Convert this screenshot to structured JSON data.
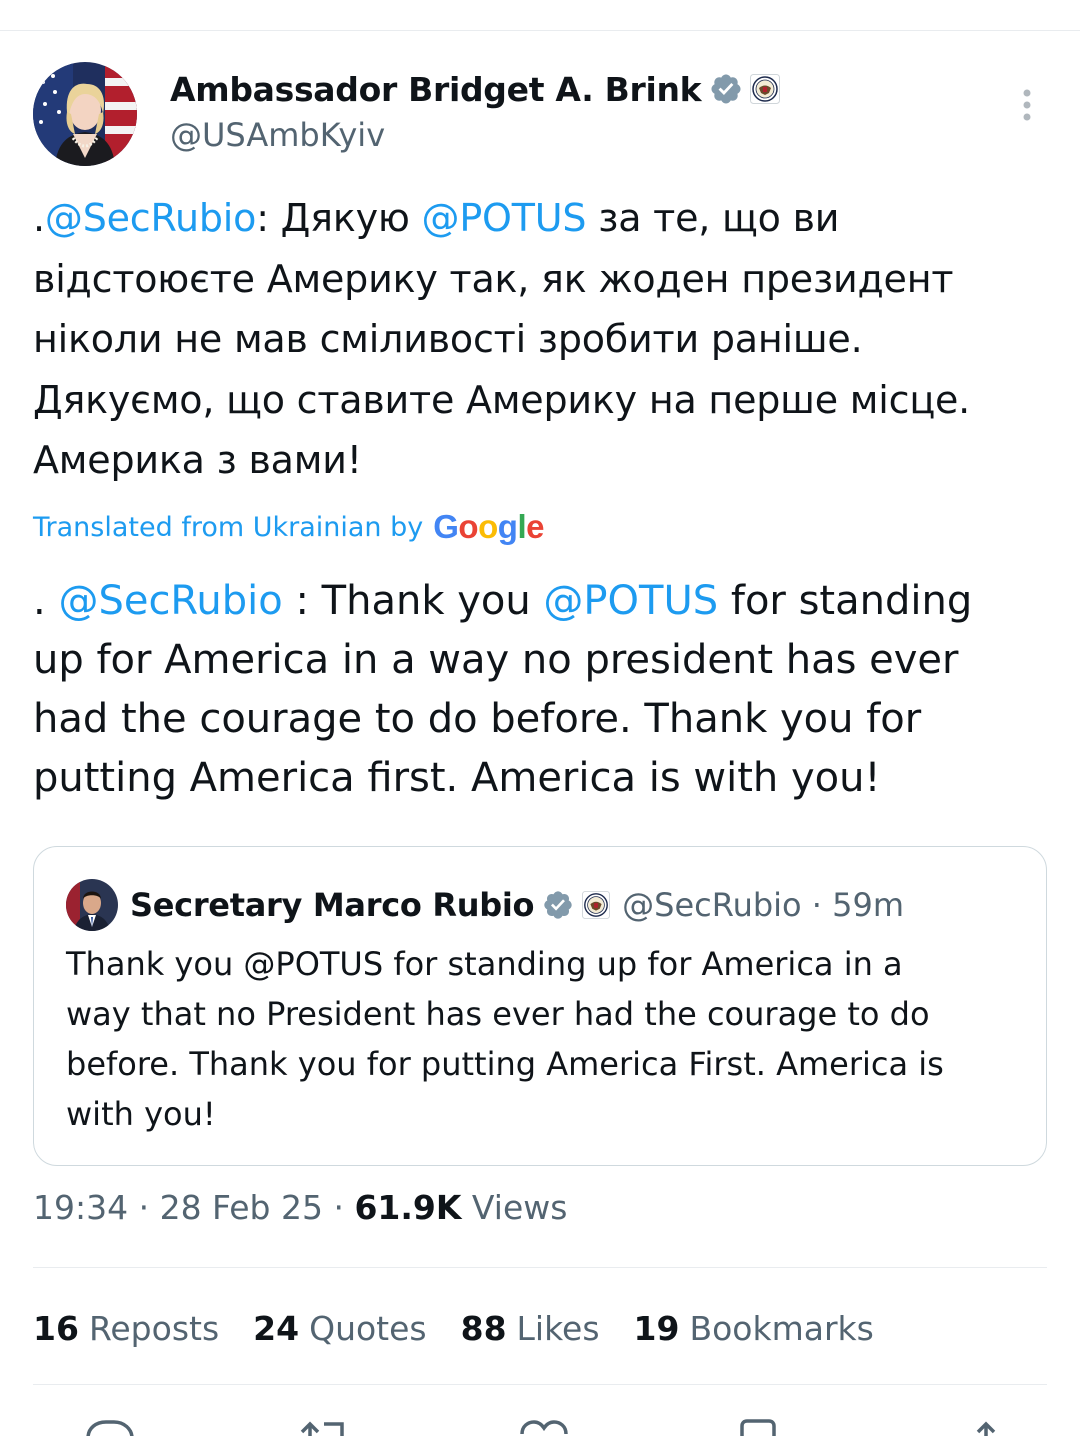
{
  "author": {
    "display_name": "Ambassador Bridget A. Brink",
    "handle": "@USAmbKyiv"
  },
  "tweet": {
    "original_lines": [
      [
        {
          "t": ".",
          "m": false
        },
        {
          "t": "@SecRubio",
          "m": true
        },
        {
          "t": ": Дякую ",
          "m": false
        },
        {
          "t": "@POTUS",
          "m": true
        },
        {
          "t": " за те, що ви",
          "m": false
        }
      ],
      [
        {
          "t": "відстоюєте Америку так, як жоден президент",
          "m": false
        }
      ],
      [
        {
          "t": "ніколи не мав сміливості зробити раніше.",
          "m": false
        }
      ],
      [
        {
          "t": "Дякуємо, що ставите Америку на перше місце.",
          "m": false
        }
      ],
      [
        {
          "t": "Америка з вами!",
          "m": false
        }
      ]
    ],
    "translated_label": "Translated from Ukrainian by",
    "translated_brand": "Google",
    "translation_lines": [
      [
        {
          "t": ". ",
          "m": false
        },
        {
          "t": "@SecRubio",
          "m": true
        },
        {
          "t": " : Thank you ",
          "m": false
        },
        {
          "t": "@POTUS",
          "m": true
        },
        {
          "t": " for standing",
          "m": false
        }
      ],
      [
        {
          "t": "up for America in a way no president has ever",
          "m": false
        }
      ],
      [
        {
          "t": "had the courage to do before. Thank you for",
          "m": false
        }
      ],
      [
        {
          "t": "putting America first. America is with you!",
          "m": false
        }
      ]
    ]
  },
  "quoted": {
    "display_name": "Secretary Marco Rubio",
    "handle_time": "@SecRubio · 59m",
    "lines": [
      "Thank you @POTUS for standing up for America in a",
      "way that no President has ever had the courage to do",
      "before. Thank you for putting America First. America is",
      "with you!"
    ]
  },
  "meta": {
    "time_date": "19:34 · 28 Feb 25 · ",
    "views_count": "61.9K",
    "views_label": " Views"
  },
  "stats": [
    {
      "num": "16",
      "label": "Reposts"
    },
    {
      "num": "24",
      "label": "Quotes"
    },
    {
      "num": "88",
      "label": "Likes"
    },
    {
      "num": "19",
      "label": "Bookmarks"
    }
  ],
  "colors": {
    "accent": "#1d9bf0",
    "text": "#0f1419",
    "secondary": "#536471",
    "border": "#cfd9de",
    "verified_badge": "#829aab"
  },
  "icons": [
    "verified-badge-icon",
    "government-seal-icon",
    "more-options-icon",
    "reply-icon",
    "repost-icon",
    "like-icon",
    "bookmark-icon",
    "share-icon"
  ]
}
